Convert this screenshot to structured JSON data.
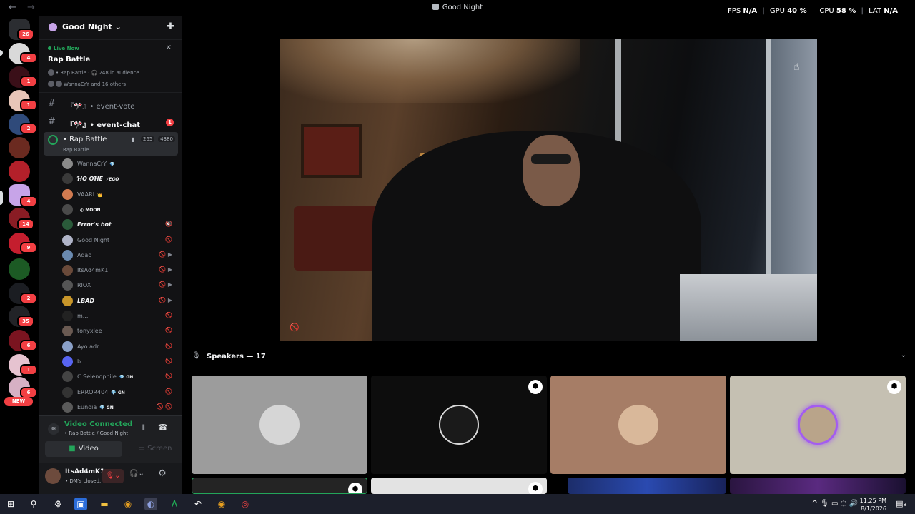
{
  "window": {
    "title": "Good Night",
    "back_icon": "←",
    "forward_icon": "→"
  },
  "stats": {
    "fps_label": "FPS",
    "fps_value": "N/A",
    "gpu_label": "GPU",
    "gpu_value": "40 %",
    "cpu_label": "CPU",
    "cpu_value": "58 %",
    "lat_label": "LAT",
    "lat_value": "N/A",
    "sep": "|"
  },
  "rail": {
    "home_badge": "26",
    "badges": [
      "4",
      "1",
      "1",
      "2",
      "4",
      "14",
      "9",
      "2",
      "35",
      "6",
      "1",
      "6"
    ],
    "new_label": "NEW"
  },
  "server": {
    "name": "Good Night",
    "chevron": "⌄",
    "invite_icon": "✚"
  },
  "live_event": {
    "status": "Live Now",
    "close": "×",
    "title": "Rap Battle",
    "meta": "• Rap Battle · 🎧 248 in audience",
    "participants": "WannaCrY and 16 others"
  },
  "channels": [
    {
      "name": "『🎌』• event-vote",
      "hash": "#"
    },
    {
      "name": "『🎌』• event-chat",
      "hash": "#",
      "badge": "1"
    }
  ],
  "voice_channel": {
    "name": "• Rap Battle",
    "subtitle": "Rap Battle",
    "cam_count": "265",
    "total": "4380"
  },
  "members": [
    {
      "name": "WannaCrY",
      "tag": "💎",
      "icons": ""
    },
    {
      "name": "ꞪО ОꞪЕ",
      "tag": "⚡EGO",
      "icons": ""
    },
    {
      "name": "VAARI",
      "tag": "👑",
      "icons": ""
    },
    {
      "name": "",
      "tag": "◐ MOON",
      "icons": ""
    },
    {
      "name": "Error's bot",
      "tag": "",
      "icons": "🔇"
    },
    {
      "name": "Good Night",
      "tag": "",
      "icons": "🚫"
    },
    {
      "name": "Adão",
      "tag": "",
      "icons": "🚫 ▶"
    },
    {
      "name": "ItsAd4mK1",
      "tag": "",
      "icons": "🚫 ▶"
    },
    {
      "name": "RIOX",
      "tag": "",
      "icons": "🚫 ▶"
    },
    {
      "name": "LBAD",
      "tag": "",
      "icons": "🚫 ▶"
    },
    {
      "name": "m...",
      "tag": "",
      "icons": "🚫"
    },
    {
      "name": "tonyxlee",
      "tag": "",
      "icons": "🚫"
    },
    {
      "name": "Ayo adr",
      "tag": "",
      "icons": "🚫"
    },
    {
      "name": "b...",
      "tag": "",
      "icons": "🚫"
    },
    {
      "name": "ℂ Selenophile",
      "tag": "💎 GN",
      "icons": "🚫"
    },
    {
      "name": "ERROR404",
      "tag": "💎 GN",
      "icons": "🚫"
    },
    {
      "name": "Eunoia",
      "tag": "💎 GN",
      "icons": "🚫 🚫"
    }
  ],
  "voice_panel": {
    "status": "Video Connected",
    "location": "• Rap Battle / Good Night",
    "video_label": "Video",
    "screen_label": "Screen"
  },
  "user": {
    "name": "ItsAd4mK1",
    "status": "• DM's closed."
  },
  "speakers": {
    "label": "Speakers — 17",
    "chevron": "⌄"
  },
  "taskbar": {
    "time": "11:25 PM",
    "date": "8/1/2026",
    "notif_count": "8"
  },
  "colors": {
    "accent_green": "#23a55a",
    "badge_red": "#f23f43",
    "sidebar_bg": "#121214"
  }
}
